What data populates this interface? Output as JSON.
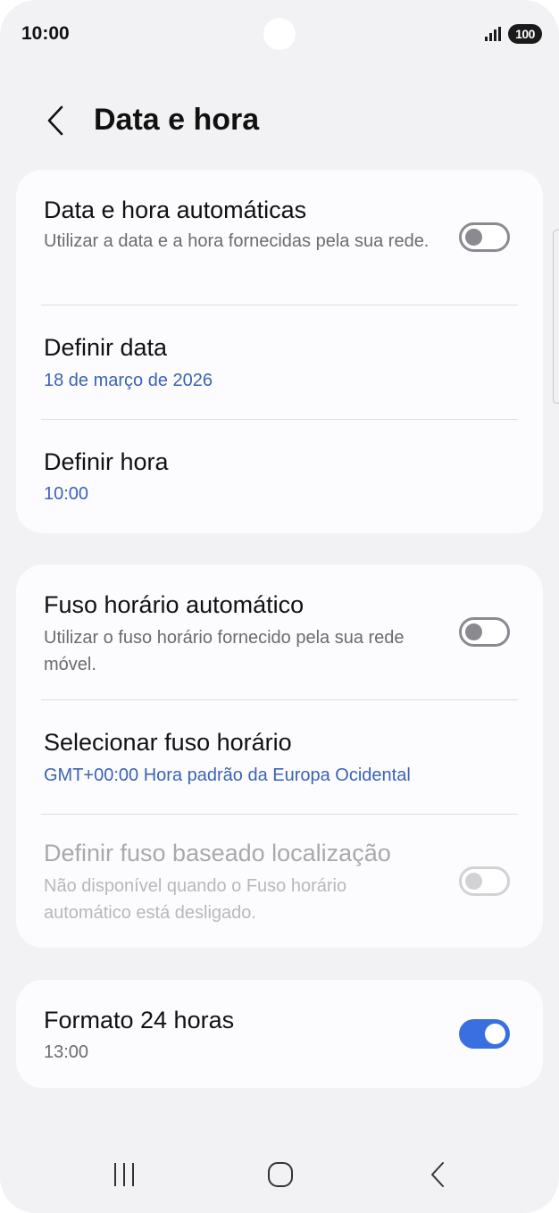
{
  "status_bar": {
    "time": "10:00",
    "battery": "100",
    "icons": [
      "signal-icon",
      "battery-icon"
    ]
  },
  "header": {
    "title": "Data e hora",
    "back_icon": "chevron-left-icon"
  },
  "sections": [
    {
      "items": [
        {
          "title": "Data e hora automáticas",
          "subtitle": "Utilizar a data e a hora fornecidas pela sua rede.",
          "toggle": false
        },
        {
          "title": "Definir data",
          "value": "18 de março de 2026"
        },
        {
          "title": "Definir hora",
          "value": "10:00"
        }
      ]
    },
    {
      "items": [
        {
          "title": "Fuso horário automático",
          "subtitle": "Utilizar o fuso horário fornecido pela sua rede móvel.",
          "toggle": false
        },
        {
          "title": "Selecionar fuso horário",
          "value": "GMT+00:00 Hora padrão da Europa Ocidental"
        },
        {
          "title": "Definir fuso baseado localização",
          "subtitle": "Não disponível quando o Fuso horário automático está desligado.",
          "toggle": false,
          "disabled": true
        }
      ]
    },
    {
      "items": [
        {
          "title": "Formato 24 horas",
          "subtitle": "13:00",
          "toggle": true
        }
      ]
    }
  ],
  "nav_bar": {
    "icons": [
      "recent-apps-icon",
      "home-icon",
      "back-icon"
    ]
  },
  "colors": {
    "accent": "#3a6fe0",
    "link_value": "#3a63b5",
    "background": "#f2f2f4",
    "card": "#fcfcfe"
  }
}
